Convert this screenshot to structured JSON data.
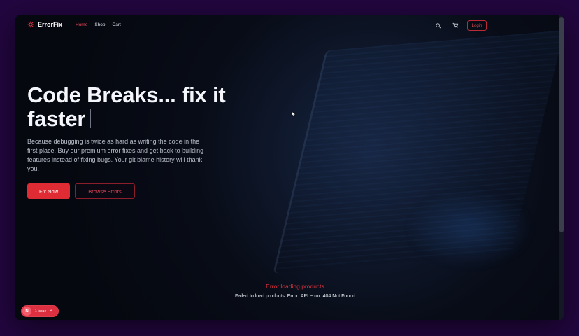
{
  "window": {
    "brand_name": "ErrorFix"
  },
  "nav": {
    "links": [
      "Home",
      "Shop",
      "Cart"
    ],
    "active": "Home",
    "login_label": "Login"
  },
  "icons": {
    "logo": "bug-icon",
    "search": "search-icon",
    "cart": "cart-icon",
    "cursor": "mouse-pointer-icon"
  },
  "hero": {
    "title_line1": "Code Breaks... fix it",
    "title_line2": "faster",
    "description": "Because debugging is twice as hard as writing the code in the first place. Buy our premium error fixes and get back to building features instead of fixing bugs. Your git blame history will thank you.",
    "primary_cta": "Fix Now",
    "secondary_cta": "Browse Errors"
  },
  "status": {
    "error_title": "Error loading products",
    "error_message": "Failed to load products: Error: API error: 404 Not Found"
  },
  "issues": {
    "badge_letter": "N",
    "label": "1 Issue",
    "close": "×"
  },
  "colors": {
    "accent": "#df2b33",
    "error_text": "#d9343f",
    "page_background": "#22063f",
    "app_background": "#090d19"
  }
}
